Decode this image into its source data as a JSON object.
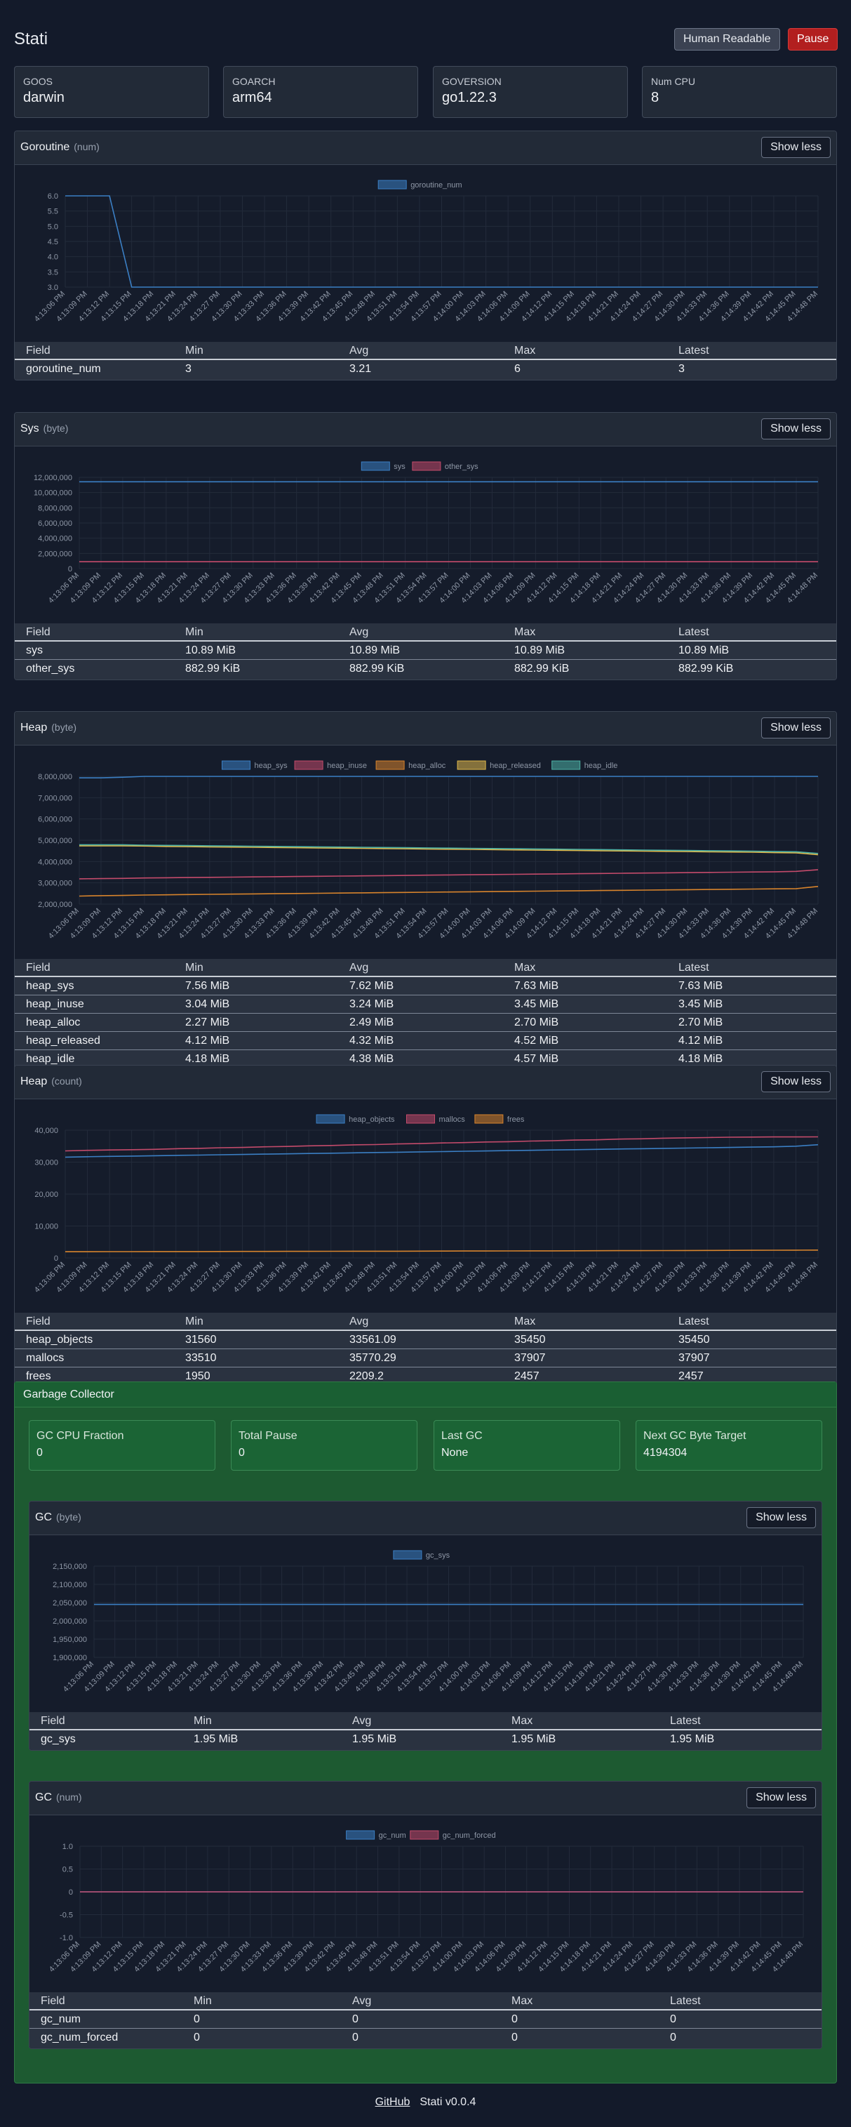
{
  "app_title": "Stati",
  "buttons": {
    "human_readable": "Human Readable",
    "pause": "Pause",
    "show_less": "Show less"
  },
  "info": [
    {
      "key": "GOOS",
      "value": "darwin"
    },
    {
      "key": "GOARCH",
      "value": "arm64"
    },
    {
      "key": "GOVERSION",
      "value": "go1.22.3"
    },
    {
      "key": "Num CPU",
      "value": "8"
    }
  ],
  "times": [
    "4:13:06 PM",
    "4:13:09 PM",
    "4:13:12 PM",
    "4:13:15 PM",
    "4:13:18 PM",
    "4:13:21 PM",
    "4:13:24 PM",
    "4:13:27 PM",
    "4:13:30 PM",
    "4:13:33 PM",
    "4:13:36 PM",
    "4:13:39 PM",
    "4:13:42 PM",
    "4:13:45 PM",
    "4:13:48 PM",
    "4:13:51 PM",
    "4:13:54 PM",
    "4:13:57 PM",
    "4:14:00 PM",
    "4:14:03 PM",
    "4:14:06 PM",
    "4:14:09 PM",
    "4:14:12 PM",
    "4:14:15 PM",
    "4:14:18 PM",
    "4:14:21 PM",
    "4:14:24 PM",
    "4:14:27 PM",
    "4:14:30 PM",
    "4:14:33 PM",
    "4:14:36 PM",
    "4:14:39 PM",
    "4:14:42 PM",
    "4:14:45 PM",
    "4:14:48 PM"
  ],
  "table_headers": [
    "Field",
    "Min",
    "Avg",
    "Max",
    "Latest"
  ],
  "gc_section": {
    "title": "Garbage Collector",
    "stats": [
      {
        "key": "GC CPU Fraction",
        "value": "0"
      },
      {
        "key": "Total Pause",
        "value": "0"
      },
      {
        "key": "Last GC",
        "value": "None"
      },
      {
        "key": "Next GC Byte Target",
        "value": "4194304"
      }
    ]
  },
  "panels": [
    {
      "title": "Goroutine",
      "unit": "(num)",
      "chart_data": {
        "type": "line",
        "yticks": [
          "6.0",
          "5.5",
          "5.0",
          "4.5",
          "4.0",
          "3.5",
          "3.0"
        ],
        "ylim": [
          3,
          6
        ],
        "series": [
          {
            "name": "goroutine_num",
            "color": "#3b7fc4",
            "values": [
              6,
              6,
              6,
              3,
              3,
              3,
              3,
              3,
              3,
              3,
              3,
              3,
              3,
              3,
              3,
              3,
              3,
              3,
              3,
              3,
              3,
              3,
              3,
              3,
              3,
              3,
              3,
              3,
              3,
              3,
              3,
              3,
              3,
              3,
              3
            ]
          }
        ]
      },
      "rows": [
        [
          "goroutine_num",
          "3",
          "3.21",
          "6",
          "3"
        ]
      ]
    },
    {
      "title": "Sys",
      "unit": "(byte)",
      "chart_data": {
        "type": "line",
        "yticks": [
          "12,000,000",
          "10,000,000",
          "8,000,000",
          "6,000,000",
          "4,000,000",
          "2,000,000",
          "0"
        ],
        "ylim": [
          0,
          12000000
        ],
        "series": [
          {
            "name": "sys",
            "color": "#3b7fc4",
            "values": [
              11420000,
              11420000,
              11420000,
              11420000,
              11420000,
              11420000,
              11420000,
              11420000,
              11420000,
              11420000,
              11420000,
              11420000,
              11420000,
              11420000,
              11420000,
              11420000,
              11420000,
              11420000,
              11420000,
              11420000,
              11420000,
              11420000,
              11420000,
              11420000,
              11420000,
              11420000,
              11420000,
              11420000,
              11420000,
              11420000,
              11420000,
              11420000,
              11420000,
              11420000,
              11420000
            ]
          },
          {
            "name": "other_sys",
            "color": "#c44b6b",
            "values": [
              904200,
              904200,
              904200,
              904200,
              904200,
              904200,
              904200,
              904200,
              904200,
              904200,
              904200,
              904200,
              904200,
              904200,
              904200,
              904200,
              904200,
              904200,
              904200,
              904200,
              904200,
              904200,
              904200,
              904200,
              904200,
              904200,
              904200,
              904200,
              904200,
              904200,
              904200,
              904200,
              904200,
              904200,
              904200
            ]
          }
        ]
      },
      "rows": [
        [
          "sys",
          "10.89 MiB",
          "10.89 MiB",
          "10.89 MiB",
          "10.89 MiB"
        ],
        [
          "other_sys",
          "882.99 KiB",
          "882.99 KiB",
          "882.99 KiB",
          "882.99 KiB"
        ]
      ]
    },
    {
      "title": "Heap",
      "unit": "(byte)",
      "chart_data": {
        "type": "line",
        "yticks": [
          "8,000,000",
          "7,000,000",
          "6,000,000",
          "5,000,000",
          "4,000,000",
          "3,000,000",
          "2,000,000"
        ],
        "ylim": [
          2000000,
          8000000
        ],
        "series": [
          {
            "name": "heap_sys",
            "color": "#3b7fc4",
            "values": [
              7930000,
              7930000,
              7960000,
              8000000,
              8000000,
              8000000,
              8000000,
              8000000,
              8000000,
              8000000,
              8000000,
              8000000,
              8000000,
              8000000,
              8000000,
              8000000,
              8000000,
              8000000,
              8000000,
              8000000,
              8000000,
              8000000,
              8000000,
              8000000,
              8000000,
              8000000,
              8000000,
              8000000,
              8000000,
              8000000,
              8000000,
              8000000,
              8000000,
              8000000,
              8000000
            ]
          },
          {
            "name": "heap_inuse",
            "color": "#c44b6b",
            "values": [
              3190000,
              3200000,
              3210000,
              3230000,
              3240000,
              3250000,
              3260000,
              3270000,
              3280000,
              3290000,
              3300000,
              3310000,
              3320000,
              3330000,
              3340000,
              3350000,
              3360000,
              3370000,
              3380000,
              3390000,
              3400000,
              3410000,
              3420000,
              3430000,
              3440000,
              3450000,
              3460000,
              3470000,
              3480000,
              3490000,
              3500000,
              3510000,
              3520000,
              3540000,
              3620000
            ]
          },
          {
            "name": "heap_alloc",
            "color": "#d8842c",
            "values": [
              2380000,
              2400000,
              2410000,
              2430000,
              2440000,
              2450000,
              2460000,
              2470000,
              2480000,
              2490000,
              2500000,
              2510000,
              2520000,
              2530000,
              2540000,
              2550000,
              2560000,
              2570000,
              2580000,
              2590000,
              2600000,
              2610000,
              2620000,
              2630000,
              2640000,
              2650000,
              2660000,
              2670000,
              2680000,
              2690000,
              2700000,
              2710000,
              2720000,
              2730000,
              2830000
            ]
          },
          {
            "name": "heap_released",
            "color": "#e0b84a",
            "values": [
              4740000,
              4740000,
              4740000,
              4730000,
              4710000,
              4700000,
              4690000,
              4680000,
              4670000,
              4660000,
              4650000,
              4640000,
              4630000,
              4620000,
              4610000,
              4600000,
              4590000,
              4580000,
              4570000,
              4560000,
              4550000,
              4540000,
              4530000,
              4520000,
              4510000,
              4500000,
              4490000,
              4480000,
              4470000,
              4460000,
              4450000,
              4440000,
              4420000,
              4410000,
              4320000
            ]
          },
          {
            "name": "heap_idle",
            "color": "#4db3a6",
            "values": [
              4790000,
              4790000,
              4790000,
              4770000,
              4760000,
              4750000,
              4740000,
              4730000,
              4720000,
              4710000,
              4700000,
              4690000,
              4680000,
              4670000,
              4660000,
              4650000,
              4640000,
              4630000,
              4620000,
              4610000,
              4600000,
              4590000,
              4580000,
              4570000,
              4560000,
              4550000,
              4540000,
              4530000,
              4520000,
              4510000,
              4500000,
              4490000,
              4470000,
              4460000,
              4380000
            ]
          }
        ]
      },
      "rows": [
        [
          "heap_sys",
          "7.56 MiB",
          "7.62 MiB",
          "7.63 MiB",
          "7.63 MiB"
        ],
        [
          "heap_inuse",
          "3.04 MiB",
          "3.24 MiB",
          "3.45 MiB",
          "3.45 MiB"
        ],
        [
          "heap_alloc",
          "2.27 MiB",
          "2.49 MiB",
          "2.70 MiB",
          "2.70 MiB"
        ],
        [
          "heap_released",
          "4.12 MiB",
          "4.32 MiB",
          "4.52 MiB",
          "4.12 MiB"
        ],
        [
          "heap_idle",
          "4.18 MiB",
          "4.38 MiB",
          "4.57 MiB",
          "4.18 MiB"
        ]
      ]
    },
    {
      "title": "Heap",
      "unit": "(count)",
      "chart_data": {
        "type": "line",
        "yticks": [
          "40,000",
          "30,000",
          "20,000",
          "10,000",
          "0"
        ],
        "ylim": [
          0,
          40000
        ],
        "series": [
          {
            "name": "heap_objects",
            "color": "#3b7fc4",
            "values": [
              31560,
              31700,
              31800,
              31900,
              32000,
              32100,
              32200,
              32300,
              32400,
              32500,
              32600,
              32700,
              32800,
              32900,
              33000,
              33100,
              33200,
              33300,
              33400,
              33500,
              33600,
              33700,
              33800,
              33900,
              34000,
              34100,
              34200,
              34300,
              34400,
              34500,
              34600,
              34700,
              34800,
              35000,
              35450
            ]
          },
          {
            "name": "mallocs",
            "color": "#c44b6b",
            "values": [
              33510,
              33700,
              33800,
              33900,
              34000,
              34200,
              34300,
              34500,
              34600,
              34800,
              34900,
              35100,
              35200,
              35400,
              35500,
              35700,
              35800,
              36000,
              36100,
              36300,
              36400,
              36600,
              36700,
              36900,
              37000,
              37200,
              37300,
              37500,
              37600,
              37700,
              37800,
              37850,
              37880,
              37900,
              37907
            ]
          },
          {
            "name": "frees",
            "color": "#d8842c",
            "values": [
              1950,
              1960,
              1970,
              1980,
              1990,
              2000,
              2010,
              2020,
              2040,
              2050,
              2060,
              2070,
              2080,
              2100,
              2110,
              2120,
              2140,
              2150,
              2170,
              2180,
              2200,
              2210,
              2230,
              2240,
              2260,
              2280,
              2290,
              2310,
              2330,
              2350,
              2370,
              2390,
              2410,
              2430,
              2457
            ]
          }
        ]
      },
      "rows": [
        [
          "heap_objects",
          "31560",
          "33561.09",
          "35450",
          "35450"
        ],
        [
          "mallocs",
          "33510",
          "35770.29",
          "37907",
          "37907"
        ],
        [
          "frees",
          "1950",
          "2209.2",
          "2457",
          "2457"
        ]
      ]
    },
    {
      "title": "GC",
      "unit": "(byte)",
      "chart_data": {
        "type": "line",
        "yticks": [
          "2,150,000",
          "2,100,000",
          "2,050,000",
          "2,000,000",
          "1,950,000",
          "1,900,000"
        ],
        "ylim": [
          1900000,
          2150000
        ],
        "series": [
          {
            "name": "gc_sys",
            "color": "#3b7fc4",
            "values": [
              2045000,
              2045000,
              2045000,
              2045000,
              2045000,
              2045000,
              2045000,
              2045000,
              2045000,
              2045000,
              2045000,
              2045000,
              2045000,
              2045000,
              2045000,
              2045000,
              2045000,
              2045000,
              2045000,
              2045000,
              2045000,
              2045000,
              2045000,
              2045000,
              2045000,
              2045000,
              2045000,
              2045000,
              2045000,
              2045000,
              2045000,
              2045000,
              2045000,
              2045000,
              2045000
            ]
          }
        ]
      },
      "rows": [
        [
          "gc_sys",
          "1.95 MiB",
          "1.95 MiB",
          "1.95 MiB",
          "1.95 MiB"
        ]
      ]
    },
    {
      "title": "GC",
      "unit": "(num)",
      "chart_data": {
        "type": "line",
        "yticks": [
          "1.0",
          "0.5",
          "0",
          "-0.5",
          "-1.0"
        ],
        "ylim": [
          -1,
          1
        ],
        "series": [
          {
            "name": "gc_num",
            "color": "#3b7fc4",
            "values": [
              0,
              0,
              0,
              0,
              0,
              0,
              0,
              0,
              0,
              0,
              0,
              0,
              0,
              0,
              0,
              0,
              0,
              0,
              0,
              0,
              0,
              0,
              0,
              0,
              0,
              0,
              0,
              0,
              0,
              0,
              0,
              0,
              0,
              0,
              0
            ]
          },
          {
            "name": "gc_num_forced",
            "color": "#c44b6b",
            "values": [
              0,
              0,
              0,
              0,
              0,
              0,
              0,
              0,
              0,
              0,
              0,
              0,
              0,
              0,
              0,
              0,
              0,
              0,
              0,
              0,
              0,
              0,
              0,
              0,
              0,
              0,
              0,
              0,
              0,
              0,
              0,
              0,
              0,
              0,
              0
            ]
          }
        ]
      },
      "rows": [
        [
          "gc_num",
          "0",
          "0",
          "0",
          "0"
        ],
        [
          "gc_num_forced",
          "0",
          "0",
          "0",
          "0"
        ]
      ]
    }
  ],
  "footer": {
    "link": "GitHub",
    "version": "Stati v0.0.4"
  }
}
